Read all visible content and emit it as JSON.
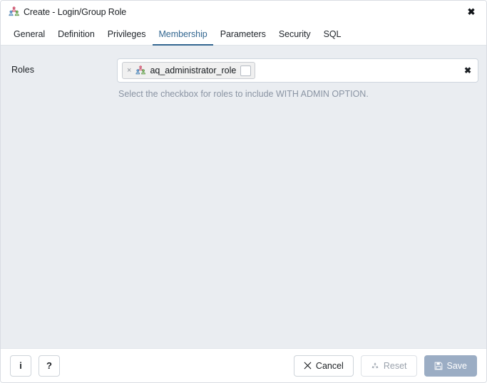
{
  "window": {
    "title": "Create - Login/Group Role",
    "title_icon": "group-role-icon",
    "close_label": "✖"
  },
  "tabs": [
    {
      "label": "General",
      "active": false
    },
    {
      "label": "Definition",
      "active": false
    },
    {
      "label": "Privileges",
      "active": false
    },
    {
      "label": "Membership",
      "active": true
    },
    {
      "label": "Parameters",
      "active": false
    },
    {
      "label": "Security",
      "active": false
    },
    {
      "label": "SQL",
      "active": false
    }
  ],
  "form": {
    "roles": {
      "label": "Roles",
      "chips": [
        {
          "remove_label": "×",
          "icon": "group-role-icon",
          "text": "aq_administrator_role",
          "checkbox_checked": false
        }
      ],
      "clear_all_label": "✖",
      "help_text": "Select the checkbox for roles to include WITH ADMIN OPTION."
    }
  },
  "footer": {
    "info_label": "i",
    "help_label": "?",
    "cancel_label": "Cancel",
    "cancel_icon": "cross-icon",
    "reset_label": "Reset",
    "reset_icon": "recycle-icon",
    "reset_disabled": true,
    "save_label": "Save",
    "save_icon": "floppy-disk-icon",
    "save_disabled": true
  },
  "colors": {
    "accent": "#326690",
    "body_background": "#eaedf1",
    "save_background": "#9badc4",
    "help_text": "#8a94a3"
  }
}
